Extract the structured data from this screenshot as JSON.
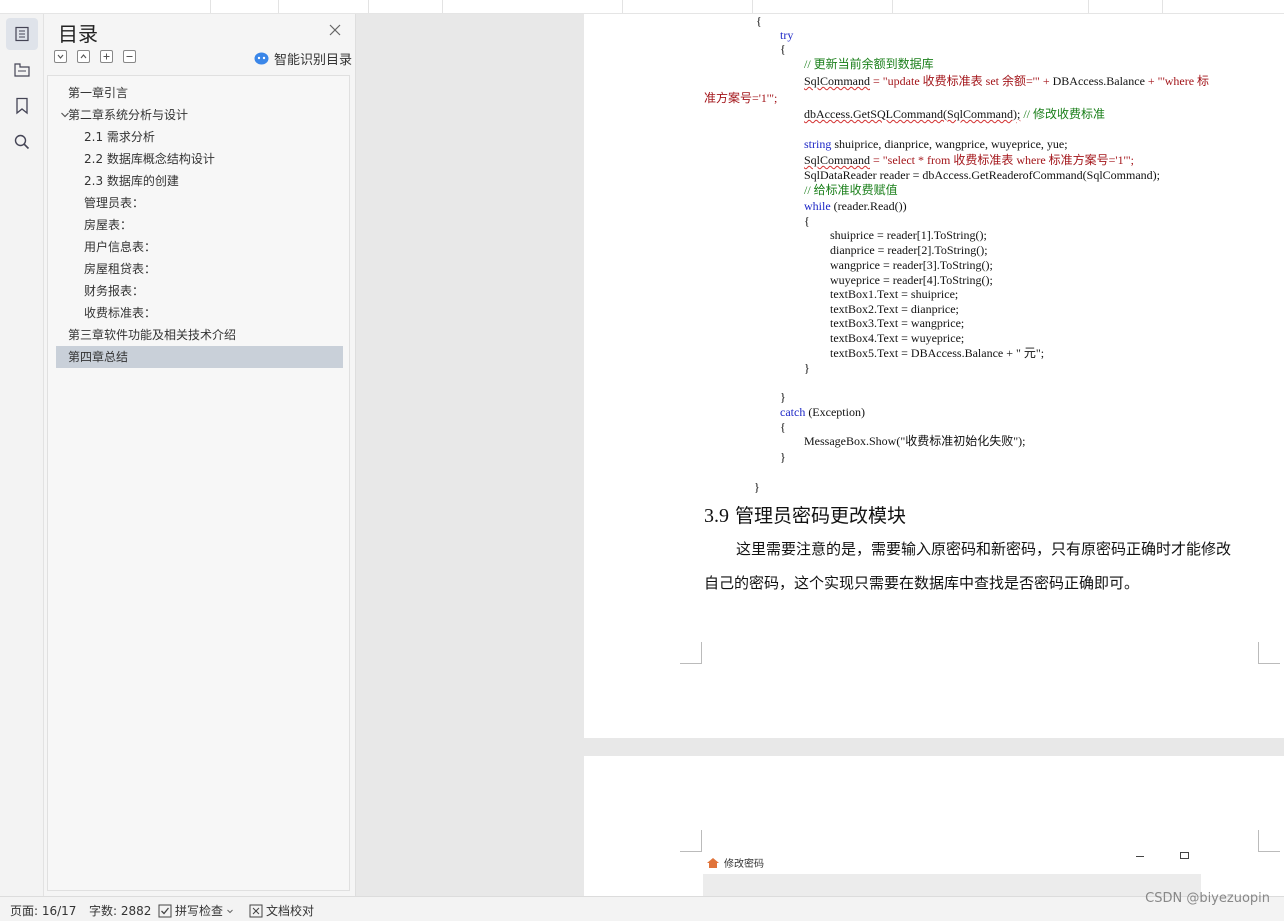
{
  "toc": {
    "title": "目录",
    "smart_label": "智能识别目录",
    "items": [
      {
        "label": "第一章引言",
        "level": 1,
        "expandable": false
      },
      {
        "label": "第二章系统分析与设计",
        "level": 1,
        "expandable": true
      },
      {
        "label": "2.1  需求分析",
        "level": 2,
        "expandable": false
      },
      {
        "label": "2.2 数据库概念结构设计",
        "level": 2,
        "expandable": false
      },
      {
        "label": "2.3 数据库的创建",
        "level": 2,
        "expandable": false
      },
      {
        "label": "管理员表：",
        "level": 2,
        "expandable": false
      },
      {
        "label": "房屋表：",
        "level": 2,
        "expandable": false
      },
      {
        "label": "用户信息表：",
        "level": 2,
        "expandable": false
      },
      {
        "label": "房屋租贷表：",
        "level": 2,
        "expandable": false
      },
      {
        "label": "财务报表：",
        "level": 2,
        "expandable": false
      },
      {
        "label": "收费标准表：",
        "level": 2,
        "expandable": false
      },
      {
        "label": "第三章软件功能及相关技术介绍",
        "level": 1,
        "expandable": false
      },
      {
        "label": "第四章总结",
        "level": 1,
        "expandable": false,
        "selected": true
      }
    ]
  },
  "rail_icons": [
    "toc-icon",
    "navigation-icon",
    "bookmark-icon",
    "search-icon"
  ],
  "document": {
    "code": {
      "brace_open": "{",
      "try": "try",
      "try_open": "{",
      "comment_update": "//  更新当前余额到数据库",
      "sql_assign": "SqlCommand",
      "sql_update_str": "= \"update  收费标准表  set  余额='\" + ",
      "sql_update_mid": "DBAccess.Balance",
      "sql_update_tail": " + \"'where  标",
      "sql_update_wrap": "准方案号='1'\";",
      "exec_line": "dbAccess.GetSQLCommand(SqlCommand);",
      "comment_modify": "//  修改收费标准",
      "string_kw": "string",
      "string_decl": " shuiprice, dianprice, wangprice, wuyeprice, yue;",
      "sql_select_lhs": "SqlCommand",
      "sql_select_str": " = \"select * from  收费标准表  where  标准方案号='1'\";",
      "reader_line": "SqlDataReader reader = dbAccess.GetReaderofCommand(SqlCommand);",
      "comment_assign": "//  给标准收费赋值",
      "while_kw": "while",
      "while_cond": " (reader.Read())",
      "while_open": "{",
      "assign_lines": [
        "shuiprice = reader[1].ToString();",
        "dianprice = reader[2].ToString();",
        "wangprice = reader[3].ToString();",
        "wuyeprice = reader[4].ToString();",
        "textBox1.Text = shuiprice;",
        "textBox2.Text = dianprice;",
        "textBox3.Text = wangprice;",
        "textBox4.Text = wuyeprice;",
        "textBox5.Text = DBAccess.Balance + \"  元\";"
      ],
      "while_close": "}",
      "try_close": "}",
      "catch_kw": "catch",
      "catch_arg": " (Exception)",
      "catch_open": "{",
      "msg_line": "MessageBox.Show(\"收费标准初始化失败\");",
      "catch_close": "}",
      "brace_close": "}"
    },
    "heading_num": "3.9",
    "heading_text": " 管理员密码更改模块",
    "para_line1": "这里需要注意的是，需要输入原密码和新密码，只有原密码正确时才能修改",
    "para_line2": "自己的密码，这个实现只需要在数据库中查找是否密码正确即可。",
    "embedded_window_title": "修改密码"
  },
  "status": {
    "page": "页面: 16/17",
    "words": "字数: 2882",
    "spell": "拼写检查",
    "proof": "文档校对",
    "watermark": "CSDN @biyezuopin"
  }
}
